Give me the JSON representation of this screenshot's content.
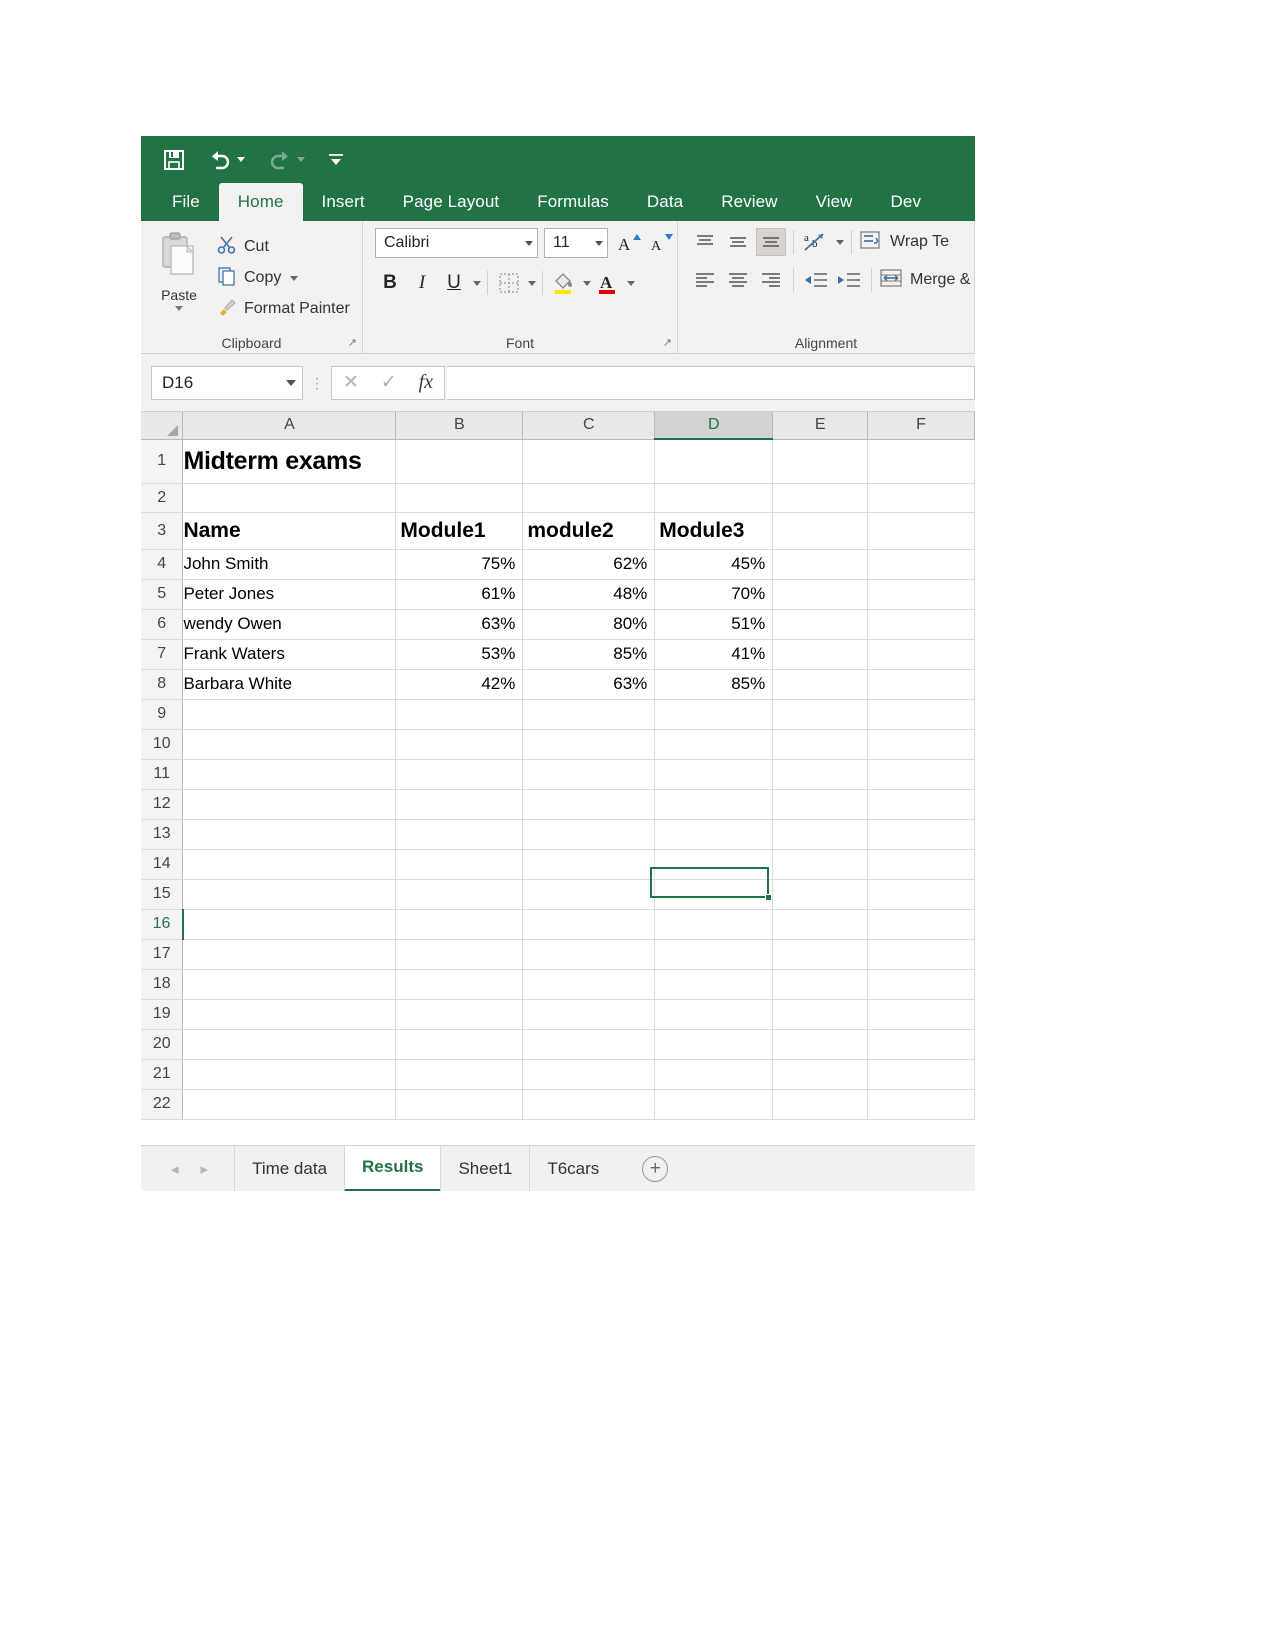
{
  "quick_access": {
    "items": [
      {
        "name": "save-icon",
        "label": "Save"
      },
      {
        "name": "undo-icon",
        "label": "Undo"
      },
      {
        "name": "redo-icon",
        "label": "Redo"
      },
      {
        "name": "customize-qat-icon",
        "label": "Customize Quick Access Toolbar"
      }
    ]
  },
  "ribbon": {
    "tabs": [
      {
        "label": "File",
        "active": false
      },
      {
        "label": "Home",
        "active": true
      },
      {
        "label": "Insert",
        "active": false
      },
      {
        "label": "Page Layout",
        "active": false
      },
      {
        "label": "Formulas",
        "active": false
      },
      {
        "label": "Data",
        "active": false
      },
      {
        "label": "Review",
        "active": false
      },
      {
        "label": "View",
        "active": false
      },
      {
        "label": "Dev",
        "active": false
      }
    ],
    "clipboard": {
      "group_label": "Clipboard",
      "paste_label": "Paste",
      "cut_label": "Cut",
      "copy_label": "Copy",
      "format_painter_label": "Format Painter",
      "launcher_glyph": "↗"
    },
    "font": {
      "group_label": "Font",
      "font_name": "Calibri",
      "font_size": "11",
      "grow_font_label": "A",
      "shrink_font_label": "A",
      "bold_label": "B",
      "italic_label": "I",
      "underline_label": "U",
      "launcher_glyph": "↗"
    },
    "alignment": {
      "group_label": "Alignment",
      "wrap_text_label": "Wrap Te",
      "merge_label": "Merge &"
    }
  },
  "formula_bar": {
    "name_box_value": "D16",
    "cancel_label": "✕",
    "enter_label": "✓",
    "function_label": "fx",
    "formula_value": "",
    "formula_placeholder": ""
  },
  "grid": {
    "columns": [
      "A",
      "B",
      "C",
      "D",
      "E",
      "F"
    ],
    "selected_column": "D",
    "selected_row": 16,
    "selected_cell": "D16",
    "rows": [
      {
        "n": 1,
        "cells": [
          "Midterm exams",
          "",
          "",
          "",
          "",
          ""
        ],
        "style": "title"
      },
      {
        "n": 2,
        "cells": [
          "",
          "",
          "",
          "",
          "",
          ""
        ],
        "style": "normal"
      },
      {
        "n": 3,
        "cells": [
          "Name",
          "Module1",
          "module2",
          "Module3",
          "",
          ""
        ],
        "style": "header"
      },
      {
        "n": 4,
        "cells": [
          "John Smith",
          "75%",
          "62%",
          "45%",
          "",
          ""
        ],
        "style": "data"
      },
      {
        "n": 5,
        "cells": [
          "Peter Jones",
          "61%",
          "48%",
          "70%",
          "",
          ""
        ],
        "style": "data"
      },
      {
        "n": 6,
        "cells": [
          "wendy Owen",
          "63%",
          "80%",
          "51%",
          "",
          ""
        ],
        "style": "data"
      },
      {
        "n": 7,
        "cells": [
          "Frank Waters",
          "53%",
          "85%",
          "41%",
          "",
          ""
        ],
        "style": "data"
      },
      {
        "n": 8,
        "cells": [
          "Barbara White",
          "42%",
          "63%",
          "85%",
          "",
          ""
        ],
        "style": "data"
      },
      {
        "n": 9,
        "cells": [
          "",
          "",
          "",
          "",
          "",
          ""
        ],
        "style": "normal"
      },
      {
        "n": 10,
        "cells": [
          "",
          "",
          "",
          "",
          "",
          ""
        ],
        "style": "normal"
      },
      {
        "n": 11,
        "cells": [
          "",
          "",
          "",
          "",
          "",
          ""
        ],
        "style": "normal"
      },
      {
        "n": 12,
        "cells": [
          "",
          "",
          "",
          "",
          "",
          ""
        ],
        "style": "normal"
      },
      {
        "n": 13,
        "cells": [
          "",
          "",
          "",
          "",
          "",
          ""
        ],
        "style": "normal"
      },
      {
        "n": 14,
        "cells": [
          "",
          "",
          "",
          "",
          "",
          ""
        ],
        "style": "normal"
      },
      {
        "n": 15,
        "cells": [
          "",
          "",
          "",
          "",
          "",
          ""
        ],
        "style": "normal"
      },
      {
        "n": 16,
        "cells": [
          "",
          "",
          "",
          "",
          "",
          ""
        ],
        "style": "normal"
      },
      {
        "n": 17,
        "cells": [
          "",
          "",
          "",
          "",
          "",
          ""
        ],
        "style": "normal"
      },
      {
        "n": 18,
        "cells": [
          "",
          "",
          "",
          "",
          "",
          ""
        ],
        "style": "normal"
      },
      {
        "n": 19,
        "cells": [
          "",
          "",
          "",
          "",
          "",
          ""
        ],
        "style": "normal"
      },
      {
        "n": 20,
        "cells": [
          "",
          "",
          "",
          "",
          "",
          ""
        ],
        "style": "normal"
      },
      {
        "n": 21,
        "cells": [
          "",
          "",
          "",
          "",
          "",
          ""
        ],
        "style": "normal"
      },
      {
        "n": 22,
        "cells": [
          "",
          "",
          "",
          "",
          "",
          ""
        ],
        "style": "normal"
      }
    ]
  },
  "sheet_tabs": {
    "prev_label": "◂",
    "next_label": "▸",
    "tabs": [
      {
        "label": "Time data",
        "active": false
      },
      {
        "label": "Results",
        "active": true
      },
      {
        "label": "Sheet1",
        "active": false
      },
      {
        "label": "T6cars",
        "active": false
      }
    ],
    "new_sheet_label": "+"
  },
  "colors": {
    "accent": "#217346",
    "ribbon_bg": "#f3f2f1",
    "grid_line": "#dcdcdc",
    "header_bg": "#e8e8e8"
  }
}
